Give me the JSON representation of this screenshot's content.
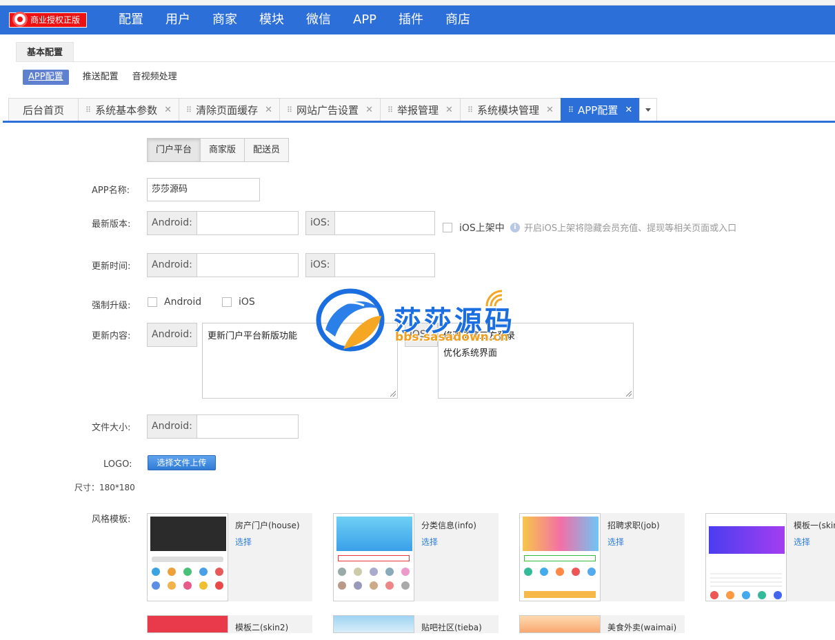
{
  "brand": {
    "badge_label": "商业授权正版"
  },
  "topnav": {
    "items": [
      "配置",
      "用户",
      "商家",
      "模块",
      "微信",
      "APP",
      "插件",
      "商店"
    ]
  },
  "section": {
    "title": "基本配置"
  },
  "subnav": {
    "items": [
      "APP配置",
      "推送配置",
      "音视频处理"
    ],
    "active_index": 0
  },
  "tabs": {
    "home": "后台首页",
    "items": [
      "系统基本参数",
      "清除页面缓存",
      "网站广告设置",
      "举报管理",
      "系统模块管理",
      "APP配置"
    ],
    "active_index": 5
  },
  "platform": {
    "options": [
      "门户平台",
      "商家版",
      "配送员"
    ],
    "active_index": 0
  },
  "form": {
    "app_name": {
      "label": "APP名称:",
      "value": "莎莎源码"
    },
    "version": {
      "label": "最新版本:",
      "android_addon": "Android:",
      "ios_addon": "iOS:",
      "android_value": "",
      "ios_value": "",
      "ios_review_label": "iOS上架中",
      "ios_review_hint": "开启iOS上架将隐藏会员充值、提现等相关页面或入口"
    },
    "update_time": {
      "label": "更新时间:",
      "android_addon": "Android:",
      "ios_addon": "iOS:",
      "android_value": "",
      "ios_value": ""
    },
    "force_upgrade": {
      "label": "强制升级:",
      "android_label": "Android",
      "ios_label": "iOS"
    },
    "update_content": {
      "label": "更新内容:",
      "android_addon": "Android:",
      "ios_addon": "iOS:",
      "android_value": "更新门户平台新版功能",
      "ios_value": "修改了第三方登录\n优化系统界面"
    },
    "file_size": {
      "label": "文件大小:",
      "android_addon": "Android:",
      "android_value": ""
    },
    "logo": {
      "label": "LOGO:",
      "upload_label": "选择文件上传",
      "size_note": "尺寸：180*180"
    },
    "templates": {
      "label": "风格模板:",
      "select_label": "选择",
      "items": [
        {
          "name": "房产门户(house)"
        },
        {
          "name": "分类信息(info)"
        },
        {
          "name": "招聘求职(job)"
        },
        {
          "name": "模板一(skin"
        },
        {
          "name": "模板二(skin2)"
        },
        {
          "name": "贴吧社区(tieba)"
        },
        {
          "name": "美食外卖(waimai)"
        }
      ]
    }
  },
  "watermark": {
    "title": "莎莎源码",
    "url": "bbs.sasadown.cn"
  },
  "colors": {
    "primary": "#2d6fd8",
    "badge": "#ee1111",
    "link": "#2d7be0"
  }
}
